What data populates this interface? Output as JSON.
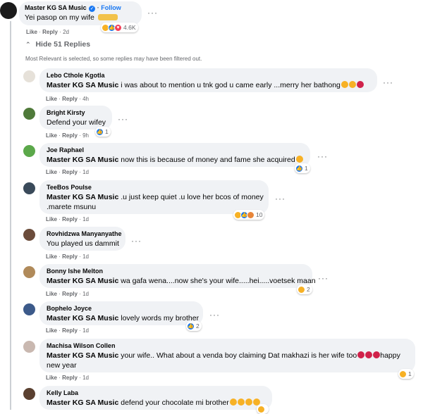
{
  "top_comment": {
    "author": "Master KG SA Music",
    "follow": "Follow",
    "text": "Yei pasop on my wife",
    "actions": [
      "Like",
      "Reply",
      "2d"
    ],
    "reactions": {
      "icons": [
        "haha",
        "like",
        "love"
      ],
      "count": "4.6K"
    }
  },
  "replies_toggle": "Hide 51 Replies",
  "filter_note": "Most Relevant is selected, so some replies may have been filtered out.",
  "comments": [
    {
      "author": "Lebo Cthole Kgotla",
      "tag": "Master KG SA Music",
      "text": "i was about to mention u tnk god u came early ...merry her bathong",
      "time": "4h",
      "reactions": null
    },
    {
      "author": "Bright Kirsty",
      "tag": "",
      "text": "Defend your wifey",
      "time": "9h",
      "reactions": {
        "icons": [
          "like"
        ],
        "count": "1"
      }
    },
    {
      "author": "Joe Raphael",
      "tag": "Master KG SA Music",
      "text": "now this is because of money and fame she acquired",
      "time": "1d",
      "reactions": {
        "icons": [
          "like"
        ],
        "count": "1"
      }
    },
    {
      "author": "TeeBos Poulse",
      "tag": "Master KG SA Music",
      "text": ".u just keep quiet .u love her bcos of money",
      "text2": ".marete msunu",
      "time": "1d",
      "reactions": {
        "icons": [
          "haha",
          "like",
          "care"
        ],
        "count": "10"
      }
    },
    {
      "author": "Rovhidzwa Manyanyathe",
      "tag": "",
      "text": "You played us dammit",
      "time": "1d",
      "reactions": null
    },
    {
      "author": "Bonny Ishe Melton",
      "tag": "Master KG SA Music",
      "text": "wa gafa wena....now she's your wife.....hei.....voetsek maan",
      "time": "1d",
      "reactions": {
        "icons": [
          "haha"
        ],
        "count": "2"
      }
    },
    {
      "author": "Bophelo Joyce",
      "tag": "Master KG SA Music",
      "text": "lovely words my brother",
      "time": "1d",
      "reactions": {
        "icons": [
          "like"
        ],
        "count": "2"
      }
    },
    {
      "author": "Machisa Wilson Collen",
      "tag": "Master KG SA Music",
      "text": "your wife.. What about a venda boy claiming Dat makhazi is her wife too",
      "text_tail": "happy",
      "text2": "new year",
      "time": "1d",
      "reactions": {
        "icons": [
          "haha"
        ],
        "count": "1"
      }
    },
    {
      "author": "Kelly Laba",
      "tag": "Master KG SA Music",
      "text": "defend your chocolate mi brother",
      "time": "",
      "reactions": {
        "icons": [
          "haha"
        ],
        "count": ""
      }
    }
  ],
  "action_labels": {
    "like": "Like",
    "reply": "Reply",
    "sep": "·"
  },
  "more_icon": "more-dots-icon",
  "colors": {
    "bubble": "#f0f2f5",
    "link": "#1877f2",
    "meta": "#65676b",
    "like": "#1877f2",
    "haha": "#f7b125",
    "love": "#f33e58"
  }
}
